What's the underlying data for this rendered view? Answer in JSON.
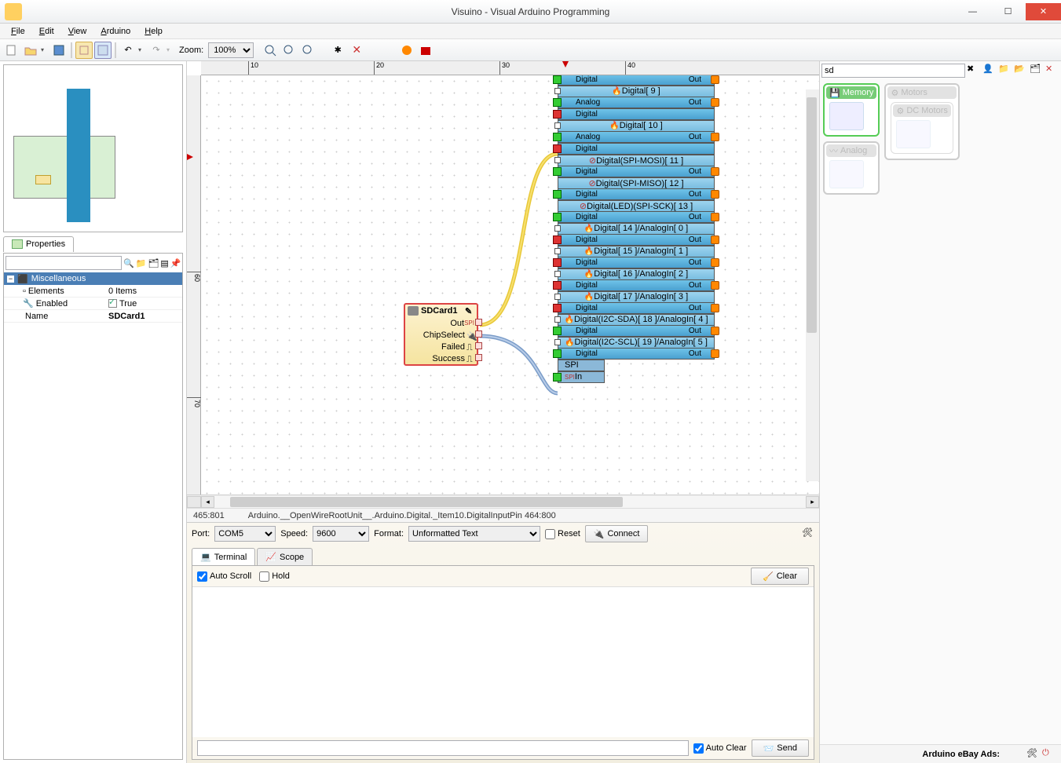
{
  "window": {
    "title": "Visuino - Visual Arduino Programming"
  },
  "menu": {
    "file": "File",
    "edit": "Edit",
    "view": "View",
    "arduino": "Arduino",
    "help": "Help"
  },
  "toolbar": {
    "zoom_label": "Zoom:",
    "zoom_value": "100%"
  },
  "ruler_h": [
    "10",
    "20",
    "30",
    "40"
  ],
  "ruler_v": [
    "60",
    "70"
  ],
  "properties": {
    "tab": "Properties",
    "group": "Miscellaneous",
    "rows": {
      "elements_k": "Elements",
      "elements_v": "0 Items",
      "enabled_k": "Enabled",
      "enabled_v": "True",
      "name_k": "Name",
      "name_v": "SDCard1"
    }
  },
  "sdcard": {
    "title": "SDCard1",
    "out": "Out",
    "cs": "ChipSelect",
    "failed": "Failed",
    "success": "Success",
    "spi": "SPI"
  },
  "arduino": {
    "digital": "Digital",
    "analog": "Analog",
    "out": "Out",
    "d9": "Digital[ 9 ]",
    "d10": "Digital[ 10 ]",
    "d11": "Digital(SPI-MOSI)[ 11 ]",
    "d12": "Digital(SPI-MISO)[ 12 ]",
    "d13": "Digital(LED)(SPI-SCK)[ 13 ]",
    "d14": "Digital[ 14 ]/AnalogIn[ 0 ]",
    "d15": "Digital[ 15 ]/AnalogIn[ 1 ]",
    "d16": "Digital[ 16 ]/AnalogIn[ 2 ]",
    "d17": "Digital[ 17 ]/AnalogIn[ 3 ]",
    "d18": "Digital(I2C-SDA)[ 18 ]/AnalogIn[ 4 ]",
    "d19": "Digital(I2C-SCL)[ 19 ]/AnalogIn[ 5 ]",
    "spi": "SPI",
    "spiin": "In"
  },
  "status": {
    "coords": "465:801",
    "path": "Arduino.__OpenWireRootUnit__.Arduino.Digital._Item10.DigitalInputPin 464:800"
  },
  "serial": {
    "port_label": "Port:",
    "port_value": "COM5",
    "speed_label": "Speed:",
    "speed_value": "9600",
    "format_label": "Format:",
    "format_value": "Unformatted Text",
    "reset": "Reset",
    "connect": "Connect",
    "tab_terminal": "Terminal",
    "tab_scope": "Scope",
    "autoscroll": "Auto Scroll",
    "hold": "Hold",
    "clear": "Clear",
    "autoclear": "Auto Clear",
    "send": "Send"
  },
  "palette": {
    "search": "sd",
    "memory": "Memory",
    "motors": "Motors",
    "analog": "Analog",
    "dcmotors": "DC Motors"
  },
  "bottom": {
    "ads": "Arduino eBay Ads:"
  }
}
